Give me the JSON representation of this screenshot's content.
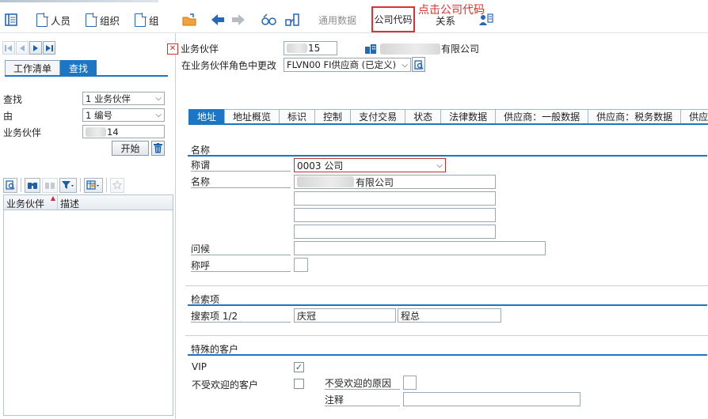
{
  "toolbar": {
    "person_label": "人员",
    "org_label": "组织",
    "group_label": "组",
    "general_data_label": "通用数据",
    "company_code_label": "公司代码",
    "relationship_label": "关系",
    "annotation": "点击公司代码"
  },
  "left": {
    "tab_worklist": "工作清单",
    "tab_find": "查找",
    "find_label": "查找",
    "find_value": "1 业务伙伴",
    "by_label": "由",
    "by_value": "1 编号",
    "bp_label": "业务伙伴",
    "bp_value": "14",
    "start_button": "开始",
    "grid_col_bp": "业务伙伴",
    "grid_col_desc": "描述"
  },
  "header": {
    "bp_label": "业务伙伴",
    "bp_value": "15",
    "bp_name_suffix": "有限公司",
    "role_label": "在业务伙伴角色中更改",
    "role_value": "FLVN00 FI供应商 (已定义)"
  },
  "tabs": [
    "地址",
    "地址概览",
    "标识",
    "控制",
    "支付交易",
    "状态",
    "法律数据",
    "供应商：一般数据",
    "供应商：税务数据",
    "供应"
  ],
  "name_section": {
    "title": "名称",
    "title_label": "称谓",
    "title_value": "0003 公司",
    "name_label": "名称",
    "name_value_suffix": "有限公司",
    "greeting_label": "问候",
    "salutation_label": "称呼"
  },
  "search_section": {
    "title": "检索项",
    "search_label": "搜索项 1/2",
    "search_value1": "庆冠",
    "search_value2": "程总"
  },
  "special_section": {
    "title": "特殊的客户",
    "vip_label": "VIP",
    "vip_checked": true,
    "unwanted_label": "不受欢迎的客户",
    "unwanted_checked": false,
    "reason_label": "不受欢迎的原因",
    "note_label": "注释"
  }
}
